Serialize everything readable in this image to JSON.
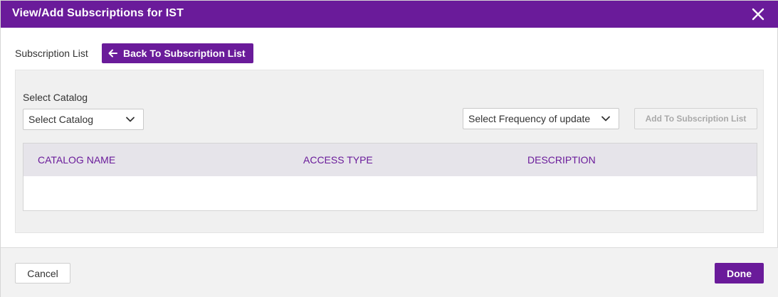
{
  "colors": {
    "primary": "#6a1b9a",
    "header_bg": "#6a1b9a",
    "panel_bg": "#f0f0f0",
    "table_header_bg": "#e6e4ea",
    "disabled_text": "#a9a9a9"
  },
  "header": {
    "title": "View/Add Subscriptions for IST",
    "close_icon": "close-icon"
  },
  "breadcrumb": {
    "label": "Subscription List",
    "back_button": "Back To Subscription List",
    "back_icon": "arrow-left-icon"
  },
  "form": {
    "catalog_label": "Select Catalog",
    "catalog_select_value": "Select Catalog",
    "frequency_select_value": "Select Frequency of update",
    "add_button": "Add To Subscription List",
    "add_button_disabled": true
  },
  "table": {
    "columns": [
      "CATALOG NAME",
      "ACCESS TYPE",
      "DESCRIPTION"
    ],
    "rows": []
  },
  "footer": {
    "cancel": "Cancel",
    "done": "Done"
  }
}
